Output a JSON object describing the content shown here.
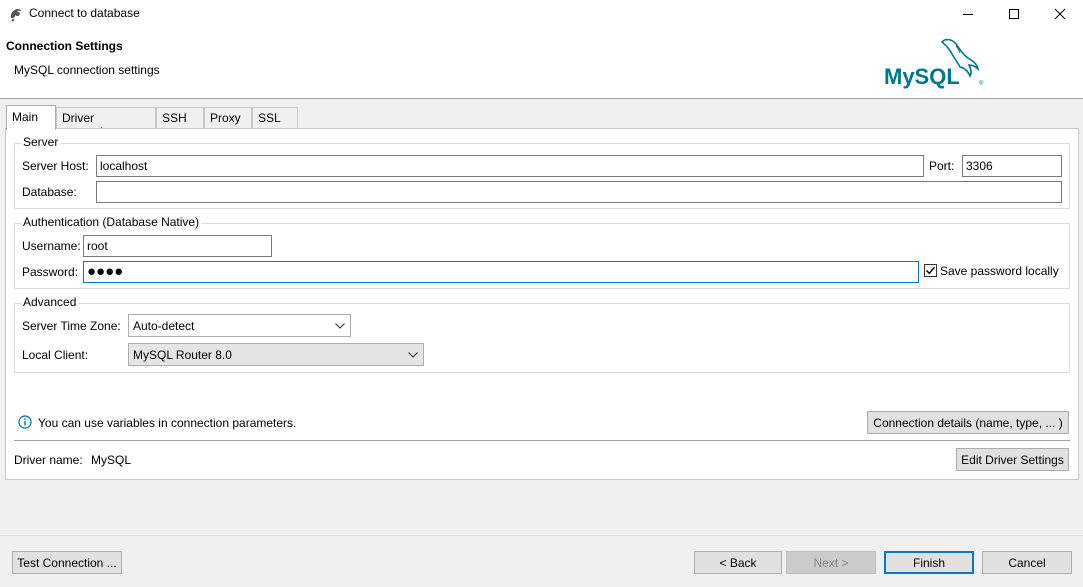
{
  "window": {
    "title": "Connect to database",
    "controls": {
      "minimize": "minimize",
      "maximize": "maximize",
      "close": "close"
    }
  },
  "header": {
    "title": "Connection Settings",
    "subtitle": "MySQL connection settings",
    "logo_text": "MySQL",
    "logo_color": "#00758f",
    "logo_accent": "#f29111"
  },
  "tabs": [
    {
      "label": "Main",
      "active": true
    },
    {
      "label": "Driver properties",
      "active": false
    },
    {
      "label": "SSH",
      "active": false
    },
    {
      "label": "Proxy",
      "active": false
    },
    {
      "label": "SSL",
      "active": false
    }
  ],
  "server": {
    "legend": "Server",
    "host_label": "Server Host:",
    "host_value": "localhost",
    "port_label": "Port:",
    "port_value": "3306",
    "database_label": "Database:",
    "database_value": ""
  },
  "auth": {
    "legend": "Authentication (Database Native)",
    "username_label": "Username:",
    "username_value": "root",
    "password_label": "Password:",
    "password_value": "●●●●",
    "save_password_label": "Save password locally",
    "save_password_checked": true
  },
  "advanced": {
    "legend": "Advanced",
    "timezone_label": "Server Time Zone:",
    "timezone_value": "Auto-detect",
    "local_client_label": "Local Client:",
    "local_client_value": "MySQL Router 8.0"
  },
  "info": {
    "message": "You can use variables in connection parameters.",
    "connection_details_button": "Connection details (name, type, ... )"
  },
  "driver": {
    "label": "Driver name:",
    "value": "MySQL",
    "edit_button": "Edit Driver Settings"
  },
  "footer": {
    "test_connection": "Test Connection ...",
    "back": "< Back",
    "next": "Next >",
    "finish": "Finish",
    "cancel": "Cancel"
  },
  "colors": {
    "focus_border": "#0078d7",
    "info_icon": "#0063b1"
  }
}
